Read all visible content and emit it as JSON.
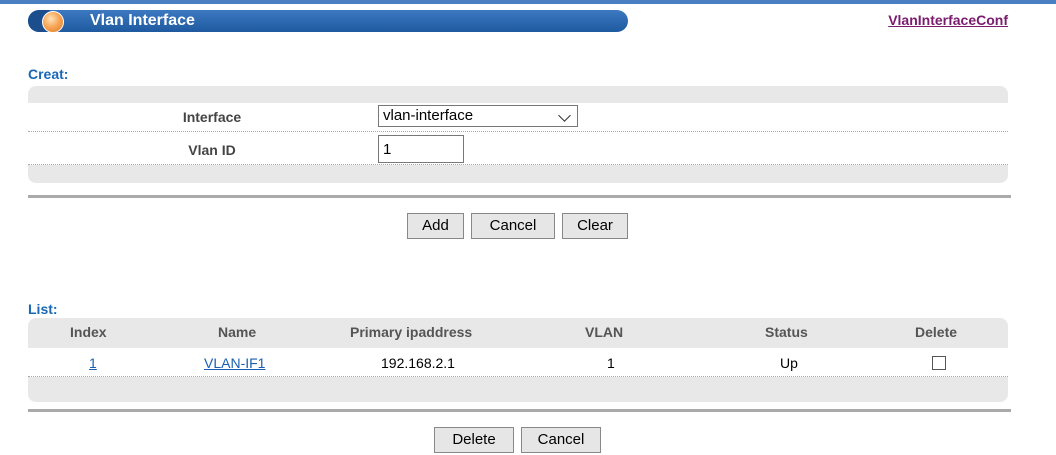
{
  "header": {
    "title": "Vlan Interface",
    "conf_link": "VlanInterfaceConf"
  },
  "creat": {
    "section_label": "Creat:",
    "interface_label": "Interface",
    "interface_value": "vlan-interface",
    "vlan_id_label": "Vlan ID",
    "vlan_id_value": "1",
    "buttons": {
      "add": "Add",
      "cancel": "Cancel",
      "clear": "Clear"
    }
  },
  "list": {
    "section_label": "List:",
    "columns": [
      "Index",
      "Name",
      "Primary ipaddress",
      "VLAN",
      "Status",
      "Delete"
    ],
    "rows": [
      {
        "index": "1",
        "name": "VLAN-IF1",
        "primary_ip": "192.168.2.1",
        "vlan": "1",
        "status": "Up",
        "delete_checked": false
      }
    ],
    "buttons": {
      "delete": "Delete",
      "cancel": "Cancel"
    }
  },
  "colors": {
    "accent": "#1a67b5",
    "title_bar": "#2a67ad",
    "conf_link": "#7a1b6e"
  }
}
